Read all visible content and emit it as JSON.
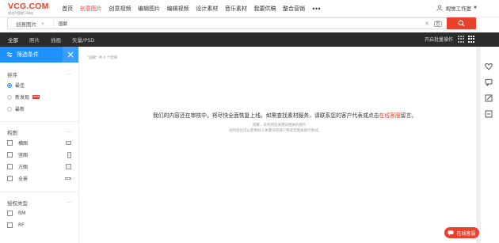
{
  "header": {
    "logo_main": "VCG.COM",
    "logo_sub": "视觉中国旗下网站",
    "nav": [
      {
        "label": "首页",
        "active": false
      },
      {
        "label": "创意图片",
        "active": true
      },
      {
        "label": "创意视频",
        "active": false
      },
      {
        "label": "编辑图片",
        "active": false
      },
      {
        "label": "编辑视频",
        "active": false
      },
      {
        "label": "设计素材",
        "active": false
      },
      {
        "label": "音乐素材",
        "active": false
      },
      {
        "label": "我要供稿",
        "active": false
      },
      {
        "label": "整合营销",
        "active": false
      }
    ],
    "more": "•••",
    "user_label": "视觉工作室"
  },
  "search": {
    "scope": "创意图片",
    "query": "国献",
    "clear": "✕"
  },
  "tabs": [
    {
      "label": "全部",
      "active": true
    },
    {
      "label": "照片",
      "active": false
    },
    {
      "label": "插画",
      "active": false
    },
    {
      "label": "矢量/PSD",
      "active": false
    }
  ],
  "toolbar": {
    "bulk_label": "开启批量操作"
  },
  "sidebar": {
    "title": "筛选条件",
    "sort": {
      "title": "排序",
      "more": "···",
      "options": [
        {
          "label": "最佳",
          "selected": true,
          "badge": ""
        },
        {
          "label": "新发现",
          "selected": false,
          "badge": "new"
        },
        {
          "label": "最新",
          "selected": false,
          "badge": ""
        }
      ]
    },
    "composition": {
      "title": "构图",
      "more": "···",
      "options": [
        {
          "label": "横图"
        },
        {
          "label": "竖图"
        },
        {
          "label": "方图"
        },
        {
          "label": "全景"
        }
      ]
    },
    "license": {
      "title": "授权类型",
      "more": "···",
      "options": [
        {
          "label": "RM"
        },
        {
          "label": "RF"
        }
      ]
    }
  },
  "main": {
    "result_text": "\"国献\" 共 0 个结果",
    "notice_pre": "我们的内容还在审核中，将尽快全面恢复上线。如需查找素材服务，请联系您的客户代表或点击",
    "notice_link": "在线客服",
    "notice_post": "留言。",
    "sub1": "抱歉，未找到您关键词相关的图片",
    "sub2": "同时您也可以使用同义关键词或减少筛选范围再进行尝试。"
  },
  "chat": {
    "label": "在线客服"
  },
  "colors": {
    "accent": "#e8422e",
    "filter_blue": "#1e90ff",
    "tabbar": "#2b2b2b"
  }
}
